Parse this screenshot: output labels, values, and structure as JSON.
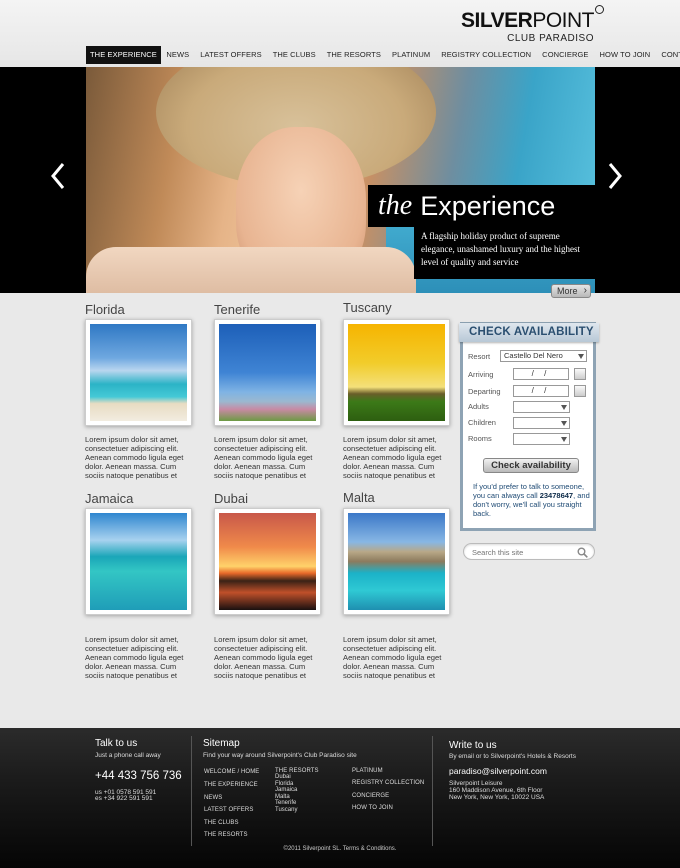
{
  "logo": {
    "bold": "SILVER",
    "thin": "POINT",
    "sub": "CLUB PARADISO"
  },
  "nav": [
    "THE EXPERIENCE",
    "NEWS",
    "LATEST OFFERS",
    "THE CLUBS",
    "THE RESORTS",
    "PLATINUM",
    "REGISTRY COLLECTION",
    "CONCIERGE",
    "HOW TO JOIN",
    "CONTACT"
  ],
  "hero": {
    "title_italic": "the",
    "title": "Experience",
    "text": "A flagship holiday product of supreme elegance, unashamed luxury and the highest level of quality and service",
    "more": "More"
  },
  "destinations": [
    {
      "name": "Florida",
      "text": "Lorem ipsum dolor sit amet, consectetuer adipiscing elit. Aenean commodo ligula eget dolor. Aenean massa. Cum sociis natoque penatibus et"
    },
    {
      "name": "Tenerife",
      "text": "Lorem ipsum dolor sit amet, consectetuer adipiscing elit. Aenean commodo ligula eget dolor. Aenean massa. Cum sociis natoque penatibus et"
    },
    {
      "name": "Tuscany",
      "text": "Lorem ipsum dolor sit amet, consectetuer adipiscing elit. Aenean commodo ligula eget dolor. Aenean massa. Cum sociis natoque penatibus et"
    },
    {
      "name": "Jamaica",
      "text": "Lorem ipsum dolor sit amet, consectetuer adipiscing elit. Aenean commodo ligula eget dolor. Aenean massa. Cum sociis natoque penatibus et"
    },
    {
      "name": "Dubai",
      "text": "Lorem ipsum dolor sit amet, consectetuer adipiscing elit. Aenean commodo ligula eget dolor. Aenean massa. Cum sociis natoque penatibus et"
    },
    {
      "name": "Malta",
      "text": "Lorem ipsum dolor sit amet, consectetuer adipiscing elit. Aenean commodo ligula eget dolor. Aenean massa. Cum sociis natoque penatibus et"
    }
  ],
  "availability": {
    "title": "CHECK AVAILABILITY",
    "resort_label": "Resort",
    "resort_value": "Castello Del Nero",
    "arriving_label": "Arriving",
    "departing_label": "Departing",
    "date_placeholder": "/ /",
    "adults_label": "Adults",
    "children_label": "Children",
    "rooms_label": "Rooms",
    "button": "Check availability",
    "note_1": "If you'd prefer to talk to someone, you can always call",
    "note_phone": "23478647",
    "note_2": ", and don't worry, we'll call you straight back."
  },
  "search": {
    "placeholder": "Search this site"
  },
  "footer": {
    "talk_title": "Talk to us",
    "talk_sub": "Just a phone call away",
    "phone": "+44 433 756 736",
    "phone_us": "us +01 0578 591 591",
    "phone_es": "es +34 922 591 591",
    "sitemap_title": "Sitemap",
    "sitemap_sub": "Find your way around Silverpoint's Club Paradiso site",
    "sitemap_col1": [
      "WELCOME / HOME",
      "THE EXPERIENCE",
      "NEWS",
      "LATEST OFFERS",
      "THE CLUBS",
      "THE RESORTS"
    ],
    "sitemap_col2_title": "THE RESORTS",
    "sitemap_col2_items": [
      "Dubai",
      "Florida",
      "Jamaica",
      "Malta",
      "Tenerife",
      "Tuscany"
    ],
    "sitemap_col3": [
      "PLATINUM",
      "REGISTRY COLLECTION",
      "CONCIERGE",
      "HOW TO JOIN"
    ],
    "write_title": "Write to us",
    "write_sub": "By email or to Silverpoint's Hotels & Resorts",
    "email": "paradiso@silverpoint.com",
    "address_1": "Silverpoint Leisure",
    "address_2": "160 Maddison Avenue, 6th Floor",
    "address_3": "New York, New York, 10022 USA",
    "copyright": "©2011 Silverpoint SL. Terms & Conditions."
  }
}
